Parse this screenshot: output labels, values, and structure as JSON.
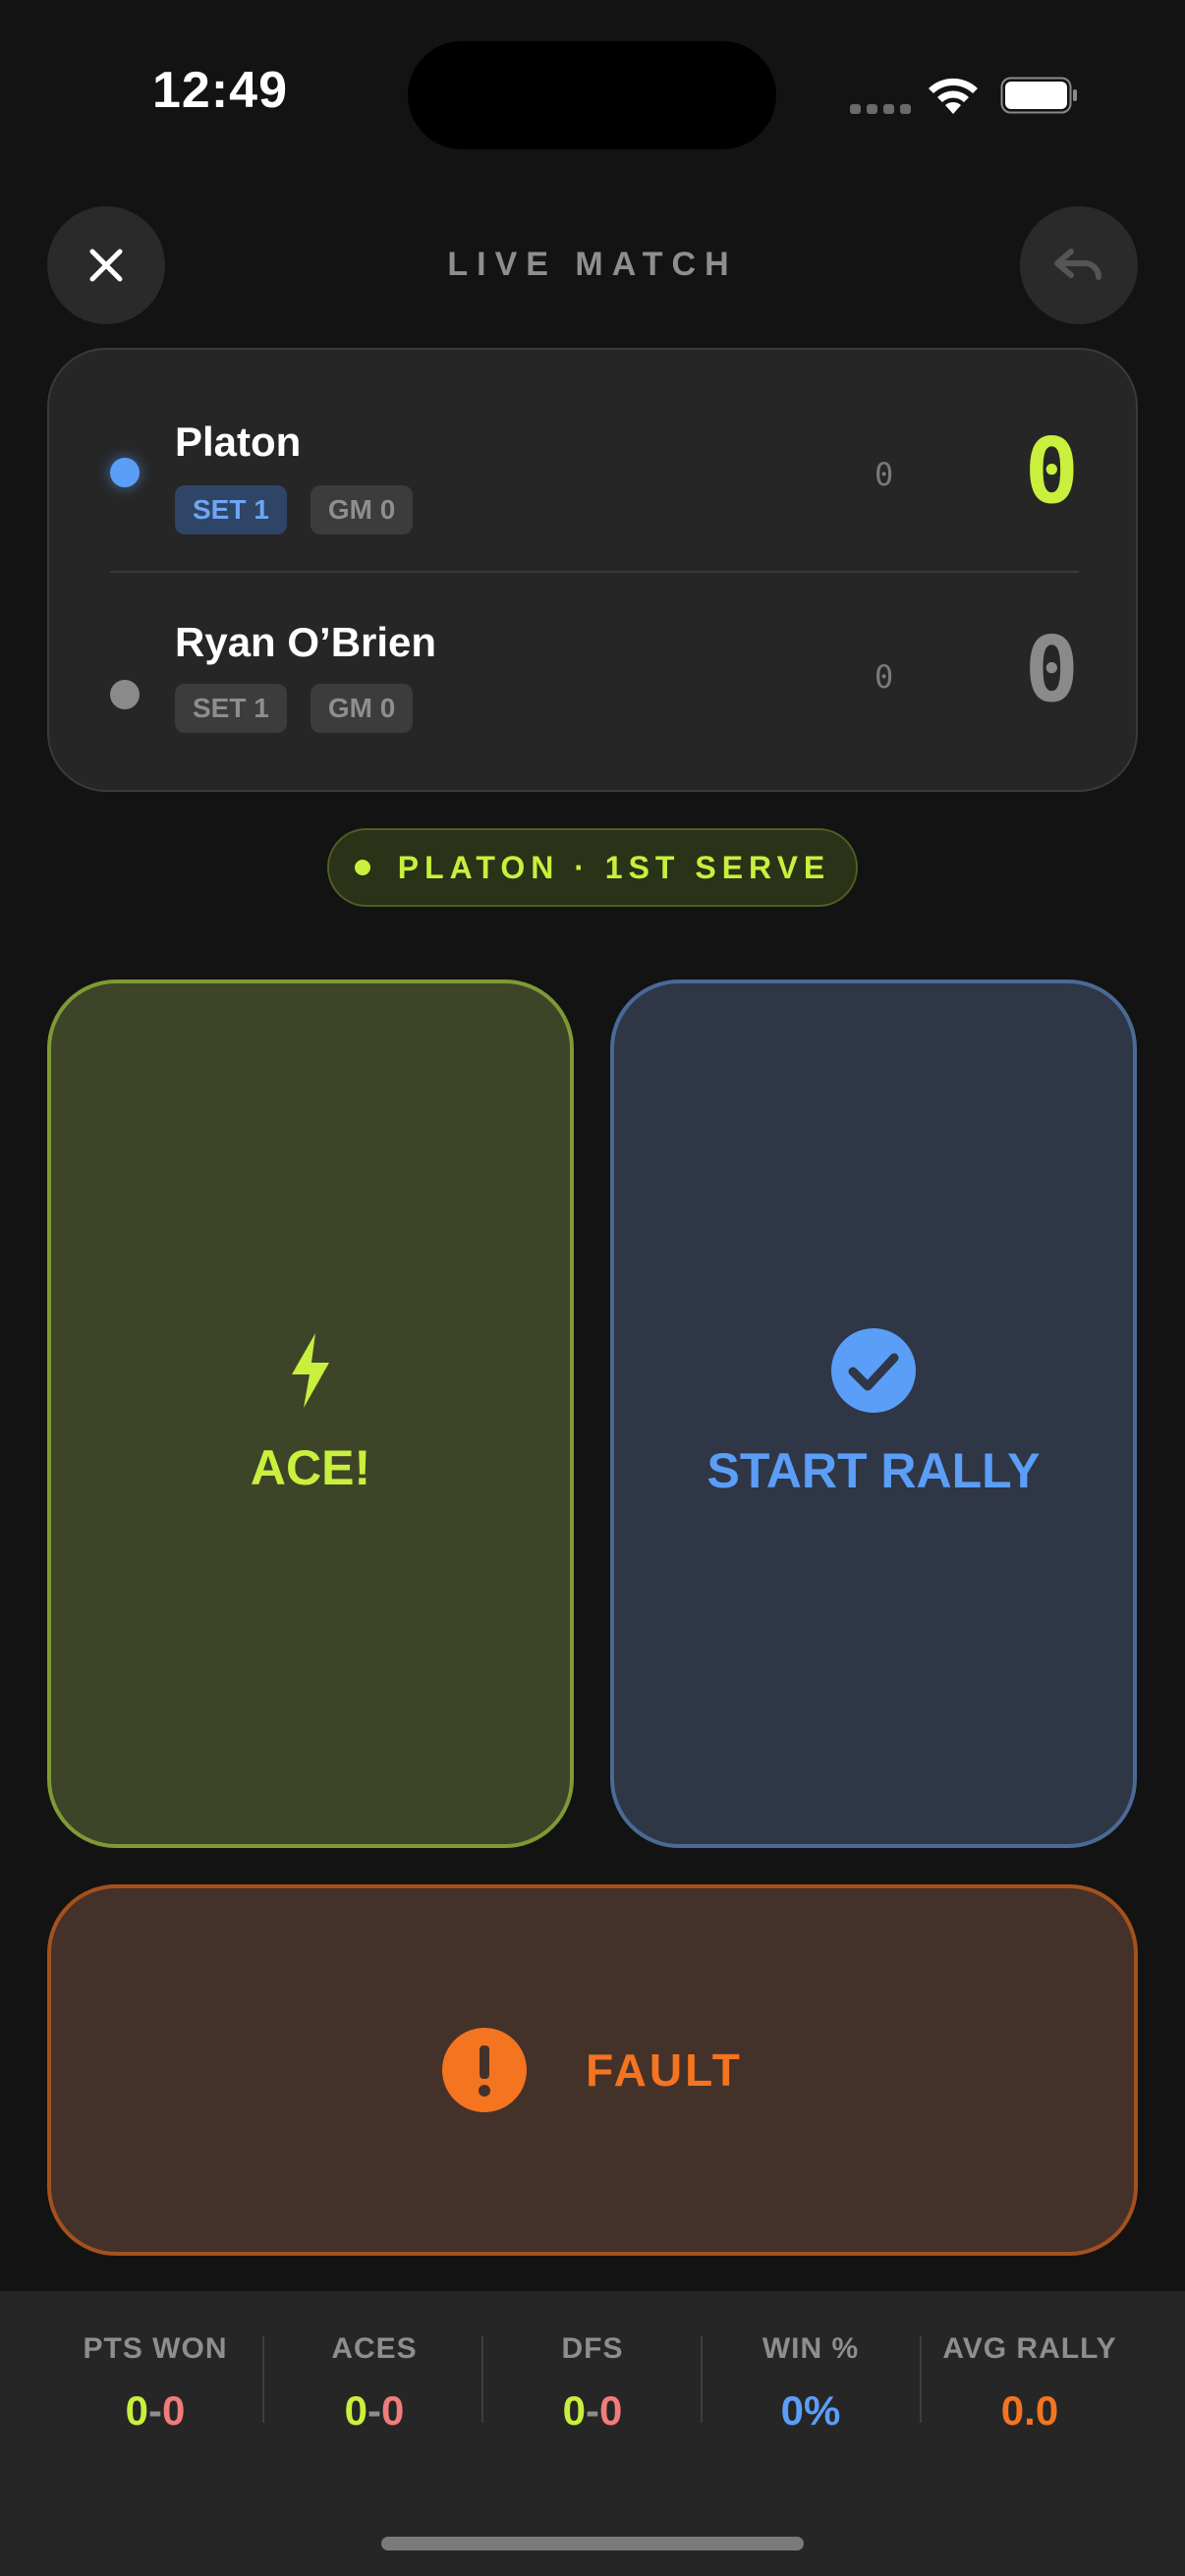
{
  "status_bar": {
    "time": "12:49"
  },
  "header": {
    "title": "LIVE MATCH",
    "close_icon": "close-icon",
    "undo_icon": "undo-icon"
  },
  "players": [
    {
      "name": "Platon",
      "set_tag": "SET 1",
      "game_tag": "GM 0",
      "games": "0",
      "points": "0",
      "serving": true
    },
    {
      "name": "Ryan O’Brien",
      "set_tag": "SET 1",
      "game_tag": "GM 0",
      "games": "0",
      "points": "0",
      "serving": false
    }
  ],
  "serve_indicator": {
    "text": "PLATON · 1ST SERVE"
  },
  "actions": {
    "ace_label": "ACE!",
    "ace_icon": "lightning-icon",
    "rally_label": "START RALLY",
    "rally_icon": "checkmark-circle-icon",
    "fault_label": "FAULT",
    "fault_icon": "exclamation-circle-icon"
  },
  "stats": [
    {
      "label": "PTS WON",
      "left": "0",
      "sep": "-",
      "right": "0"
    },
    {
      "label": "ACES",
      "left": "0",
      "sep": "-",
      "right": "0"
    },
    {
      "label": "DFS",
      "left": "0",
      "sep": "-",
      "right": "0"
    },
    {
      "label": "WIN %",
      "value": "0%"
    },
    {
      "label": "AVG RALLY",
      "value": "0.0"
    }
  ],
  "colors": {
    "accent_green": "#c8f03c",
    "accent_blue": "#5b9ef7",
    "accent_orange": "#f47420",
    "loss_red": "#f07c7c",
    "background": "#131313"
  }
}
